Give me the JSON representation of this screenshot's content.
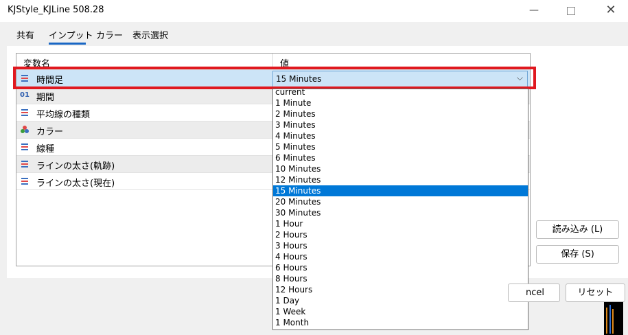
{
  "window": {
    "title": "KJStyle_KJLine 508.28",
    "min_glyph": "—",
    "close_glyph": "✕"
  },
  "tabs": [
    {
      "label": "共有"
    },
    {
      "label": "インプット",
      "active": true
    },
    {
      "label": "カラー"
    },
    {
      "label": "表示選択"
    }
  ],
  "grid": {
    "col_name": "変数名",
    "col_value": "値",
    "rows": [
      {
        "icon": "list-icon",
        "label": "時間足"
      },
      {
        "icon": "number-icon",
        "label": "期間",
        "icon_text": "01"
      },
      {
        "icon": "list-icon",
        "label": "平均線の種類"
      },
      {
        "icon": "palette-icon",
        "label": "カラー"
      },
      {
        "icon": "list-icon",
        "label": "線種"
      },
      {
        "icon": "list-icon",
        "label": "ラインの太さ(軌跡)"
      },
      {
        "icon": "list-icon",
        "label": "ラインの太さ(現在)"
      }
    ]
  },
  "combo": {
    "value": "15 Minutes",
    "arrow_glyph": "⌵"
  },
  "dropdown": {
    "selected_index": 9,
    "options": [
      "current",
      "1 Minute",
      "2 Minutes",
      "3 Minutes",
      "4 Minutes",
      "5 Minutes",
      "6 Minutes",
      "10 Minutes",
      "12 Minutes",
      "15 Minutes",
      "20 Minutes",
      "30 Minutes",
      "1 Hour",
      "2 Hours",
      "3 Hours",
      "4 Hours",
      "6 Hours",
      "8 Hours",
      "12 Hours",
      "1 Day",
      "1 Week",
      "1 Month"
    ]
  },
  "buttons": {
    "load": "読み込み (L)",
    "save": "保存 (S)",
    "cancel": "ncel",
    "reset": "リセット"
  },
  "colors": {
    "highlight": "#e0181f",
    "selection": "#0078d7",
    "row_selected": "#cce4f7",
    "tab_accent": "#1a67c4"
  }
}
